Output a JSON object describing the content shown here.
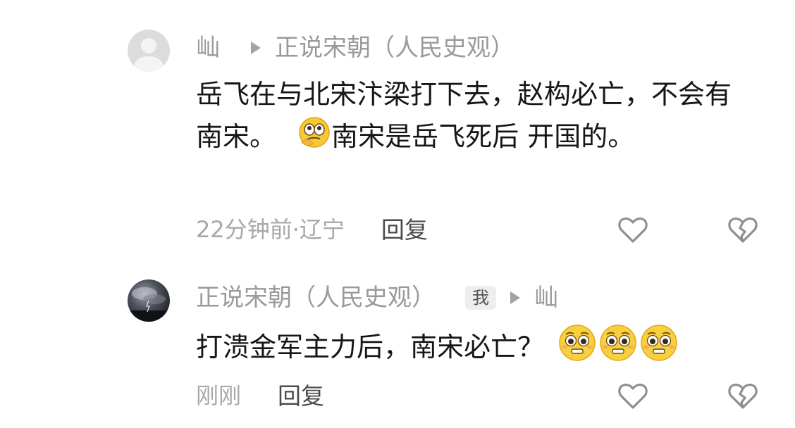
{
  "comments": [
    {
      "author": "屾",
      "reply_to": "正说宋朝（人民史观）",
      "text_part1": "岳飞在与北宋汴梁打下去，赵构必亡，不会有南宋。",
      "emoji": "thinking-eyes-emoji",
      "text_part2": "南宋是岳飞死后 开国的。",
      "time": "22分钟前·辽宁",
      "reply_label": "回复",
      "like_icon": "heart-icon",
      "dislike_icon": "broken-heart-icon"
    },
    {
      "author": "正说宋朝（人民史观）",
      "me_badge": "我",
      "reply_to": "屾",
      "text": "打溃金军主力后，南宋必亡？",
      "emoji": "pleading-face-emoji",
      "time": "刚刚",
      "reply_label": "回复",
      "like_icon": "heart-icon",
      "dislike_icon": "broken-heart-icon"
    }
  ]
}
